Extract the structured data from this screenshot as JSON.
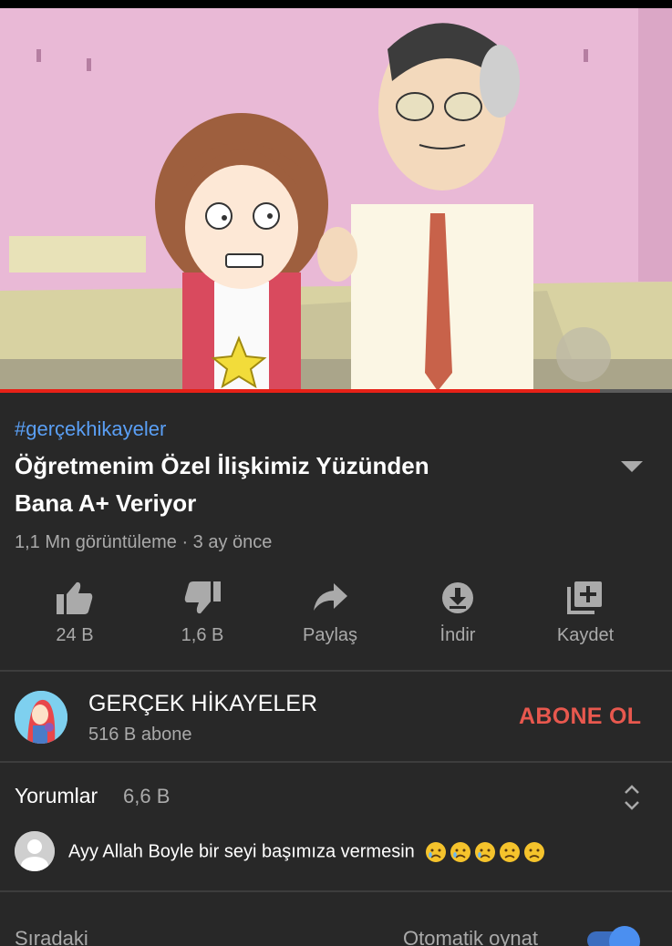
{
  "video": {
    "watermark_text": "GERÇEK HİKAYELER",
    "progress_fraction": 0.893
  },
  "info": {
    "hashtag": "#gerçekhikayeler",
    "title_line1": "Öğretmenim Özel İlişkimiz Yüzünden",
    "title_line2": "Bana A+ Veriyor",
    "meta": "1,1 Mn görüntüleme · 3 ay önce"
  },
  "actions": [
    {
      "icon": "thumbs-up-icon",
      "label": "24 B"
    },
    {
      "icon": "thumbs-down-icon",
      "label": "1,6 B"
    },
    {
      "icon": "share-icon",
      "label": "Paylaş"
    },
    {
      "icon": "download-icon",
      "label": "İndir"
    },
    {
      "icon": "save-playlist-icon",
      "label": "Kaydet"
    }
  ],
  "channel": {
    "name": "GERÇEK HİKAYELER",
    "subscribers": "516 B abone",
    "subscribe_label": "ABONE OL"
  },
  "comments": {
    "label": "Yorumlar",
    "count": "6,6 B",
    "top_comment": "Ayy Allah Boyle bir seyi başımıza vermesin",
    "emojis": [
      "crying-face",
      "crying-face",
      "crying-face",
      "frowning-face",
      "frowning-face"
    ]
  },
  "up_next": {
    "label": "Sıradaki",
    "autoplay_label": "Otomatik oynat",
    "autoplay_on": true
  },
  "colors": {
    "background": "#282828",
    "link_blue": "#5a9ff5",
    "subscribe_red": "#e8584e",
    "progress_red": "#e62117",
    "toggle_blue": "#4b8ff0"
  }
}
